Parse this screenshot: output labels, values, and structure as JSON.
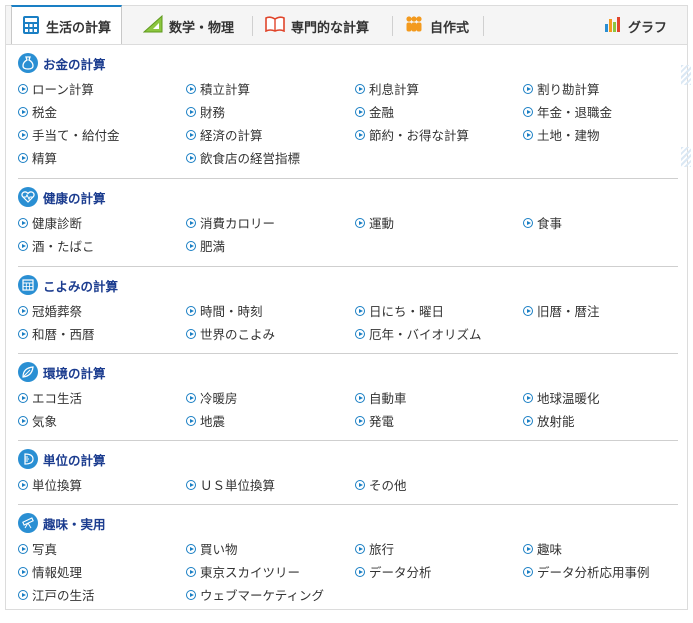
{
  "tabs": [
    {
      "label": "生活の計算",
      "icon": "calculator-icon",
      "active": true
    },
    {
      "label": "数学・物理",
      "icon": "set-square-icon"
    },
    {
      "label": "専門的な計算",
      "icon": "book-icon"
    },
    {
      "label": "自作式",
      "icon": "people-icon"
    },
    {
      "label": "グラフ",
      "icon": "bar-chart-icon"
    }
  ],
  "colors": {
    "accent": "#1a7fc4",
    "section_title": "#1b3c8f",
    "icon_bg": "#2a8fd3"
  },
  "sections": [
    {
      "title": "お金の計算",
      "icon": "money-bag-icon",
      "items": [
        "ローン計算",
        "積立計算",
        "利息計算",
        "割り勘計算",
        "税金",
        "財務",
        "金融",
        "年金・退職金",
        "手当て・給付金",
        "経済の計算",
        "節約・お得な計算",
        "土地・建物",
        "精算",
        "飲食店の経営指標"
      ]
    },
    {
      "title": "健康の計算",
      "icon": "heartbeat-icon",
      "items": [
        "健康診断",
        "消費カロリー",
        "運動",
        "食事",
        "酒・たばこ",
        "肥満"
      ]
    },
    {
      "title": "こよみの計算",
      "icon": "calendar-icon",
      "items": [
        "冠婚葬祭",
        "時間・時刻",
        "日にち・曜日",
        "旧暦・暦注",
        "和暦・西暦",
        "世界のこよみ",
        "厄年・バイオリズム"
      ]
    },
    {
      "title": "環境の計算",
      "icon": "leaf-icon",
      "items": [
        "エコ生活",
        "冷暖房",
        "自動車",
        "地球温暖化",
        "気象",
        "地震",
        "発電",
        "放射能"
      ]
    },
    {
      "title": "単位の計算",
      "icon": "ruler-icon",
      "items": [
        "単位換算",
        "ＵＳ単位換算",
        "その他"
      ]
    },
    {
      "title": "趣味・実用",
      "icon": "telescope-icon",
      "items": [
        "写真",
        "買い物",
        "旅行",
        "趣味",
        "情報処理",
        "東京スカイツリー",
        "データ分析",
        "データ分析応用事例",
        "江戸の生活",
        "ウェブマーケティング"
      ]
    }
  ]
}
